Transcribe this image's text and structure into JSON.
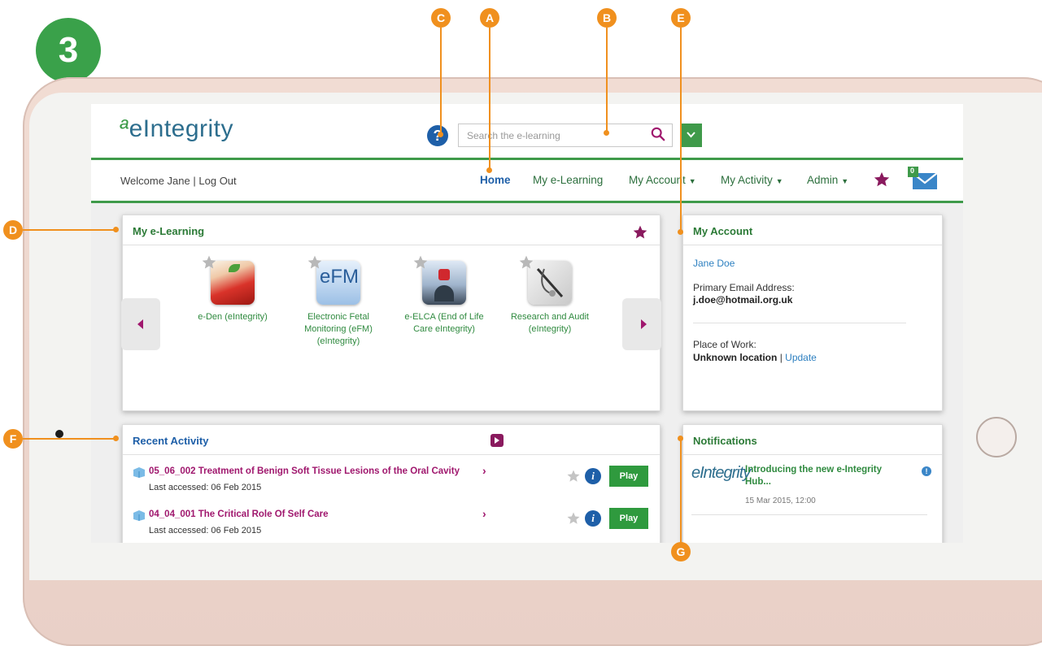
{
  "step_number": "3",
  "callouts": {
    "a": "A",
    "b": "B",
    "c": "C",
    "d": "D",
    "e": "E",
    "f": "F",
    "g": "G"
  },
  "header": {
    "logo": "eIntegrity",
    "help_label": "?",
    "search": {
      "placeholder": "Search the e-learning",
      "icon": "search-icon"
    }
  },
  "nav": {
    "welcome": "Welcome Jane",
    "separator": "|",
    "logout": "Log Out",
    "items": [
      {
        "label": "Home"
      },
      {
        "label": "My e-Learning"
      },
      {
        "label": "My Account"
      },
      {
        "label": "My Activity"
      },
      {
        "label": "Admin"
      }
    ],
    "mail_count": "0"
  },
  "my_elearning": {
    "title": "My e-Learning",
    "courses": [
      {
        "label": "e-Den (eIntegrity)",
        "icon": "apple-icon"
      },
      {
        "label": "Electronic Fetal Monitoring (eFM) (eIntegrity)",
        "thumb_text": "eFM",
        "icon": "efm-icon"
      },
      {
        "label": "e-ELCA (End of Life Care eIntegrity)",
        "icon": "elca-icon"
      },
      {
        "label": "Research and Audit (eIntegrity)",
        "icon": "research-icon"
      }
    ]
  },
  "my_account": {
    "title": "My Account",
    "name": "Jane Doe",
    "email_label": "Primary Email Address:",
    "email": "j.doe@hotmail.org.uk",
    "work_label": "Place of Work:",
    "work_value": "Unknown location",
    "separator": "|",
    "update_link": "Update"
  },
  "recent_activity": {
    "title": "Recent Activity",
    "rows": [
      {
        "title": "05_06_002 Treatment of Benign Soft Tissue Lesions of the Oral Cavity",
        "accessed": "Last accessed: 06 Feb 2015",
        "play": "Play",
        "info": "i"
      },
      {
        "title": "04_04_001 The Critical Role Of Self Care",
        "accessed": "Last accessed: 06 Feb 2015",
        "play": "Play",
        "info": "i"
      }
    ]
  },
  "notifications": {
    "title": "Notifications",
    "logo": "eIntegrity",
    "item_title_line1": "Introducing the new e-Integrity",
    "item_title_line2": "Hub...",
    "item_date": "15 Mar 2015, 12:00"
  },
  "colors": {
    "brand_green": "#3f9a4a",
    "brand_blue": "#1e5fa8",
    "accent_magenta": "#a0186e",
    "callout_orange": "#f0901e"
  }
}
